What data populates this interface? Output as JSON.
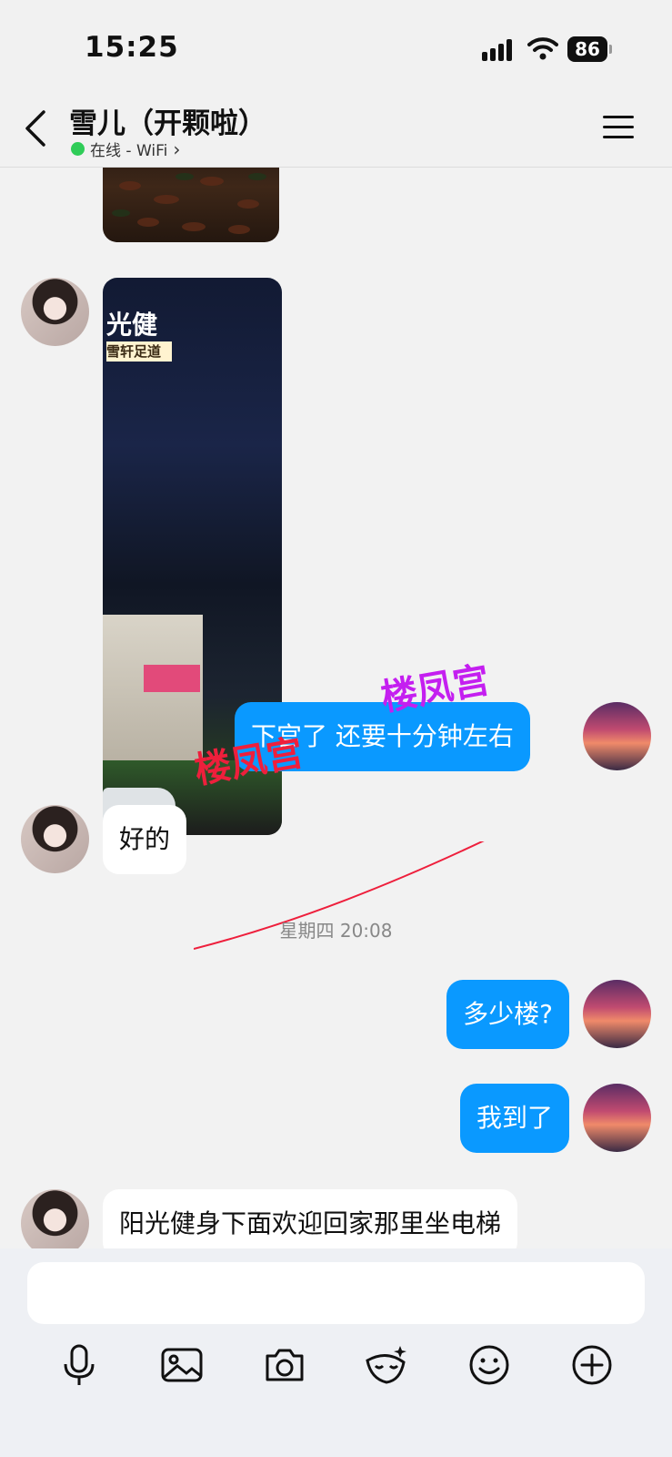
{
  "status_bar": {
    "time": "15:25",
    "battery": "86"
  },
  "header": {
    "back_icon": "chevron-left-icon",
    "contact_name": "雪儿（开颗啦）",
    "online_status": "在线 - WiFi",
    "status_chevron": "›",
    "menu_icon": "hamburger-menu-icon"
  },
  "messages": [
    {
      "type": "image",
      "from": "other"
    },
    {
      "type": "image",
      "from": "other"
    },
    {
      "type": "text",
      "from": "me",
      "text": "下宫了 还要十分钟左右"
    },
    {
      "type": "text",
      "from": "other",
      "text": "好的"
    },
    {
      "type": "timestamp",
      "text": "星期四 20:08"
    },
    {
      "type": "text",
      "from": "me",
      "text": "多少楼?"
    },
    {
      "type": "text",
      "from": "me",
      "text": "我到了"
    },
    {
      "type": "text",
      "from": "other",
      "text": "阳光健身下面欢迎回家那里坐电梯"
    }
  ],
  "watermarks": {
    "stamp_1": "楼凤宫",
    "stamp_2": "楼凤宫"
  },
  "photo_text": {
    "sign_main": "光健",
    "sign_sub": "雪轩足道"
  },
  "toolbar": [
    {
      "icon": "microphone-icon"
    },
    {
      "icon": "image-icon"
    },
    {
      "icon": "camera-icon"
    },
    {
      "icon": "sticker-icon"
    },
    {
      "icon": "emoji-icon"
    },
    {
      "icon": "plus-icon"
    }
  ],
  "colors": {
    "accent": "#0a99ff",
    "online": "#2fcc58",
    "background": "#f2f2f2"
  }
}
